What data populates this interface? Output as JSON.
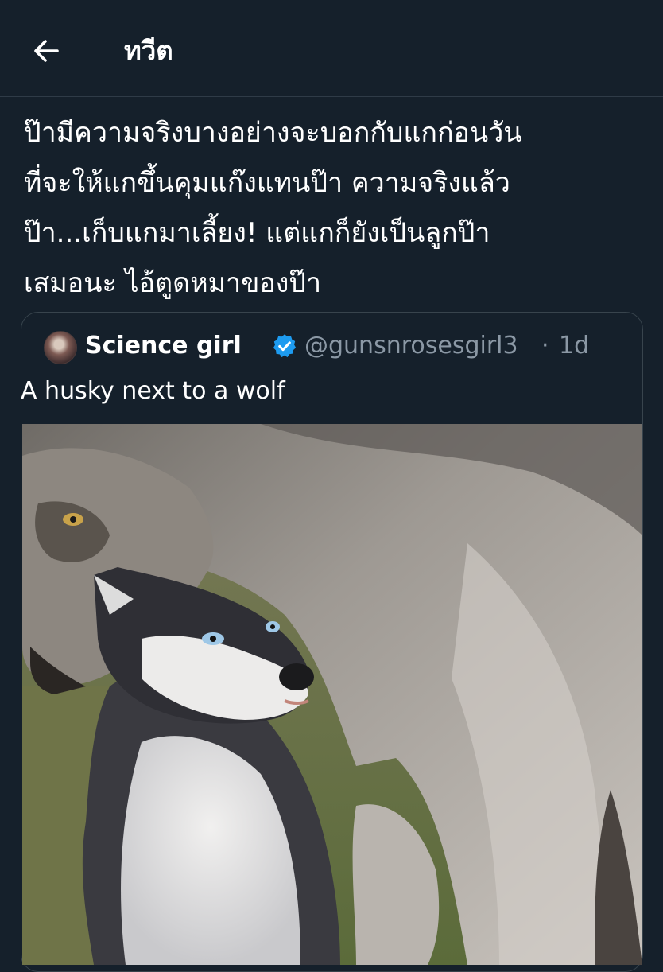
{
  "header": {
    "title": "ทวีต",
    "back_icon": "arrow-left-icon"
  },
  "tweet": {
    "text": "ป๊ามีความจริงบางอย่างจะบอกกับแกก่อนวัน\nที่จะให้แกขึ้นคุมแก๊งแทนป๊า ความจริงแล้ว\nป๊า...เก็บแกมาเลี้ยง! แต่แกก็ยังเป็นลูกป๊า\nเสมอนะ ไอ้ตูดหมาของป๊า"
  },
  "quote": {
    "author_name": "Science girl",
    "verified_icon": "verified-badge-icon",
    "handle": "@gunsnrosesgirl3",
    "separator": "·",
    "time": "1d",
    "text": "A husky next to a wolf"
  },
  "colors": {
    "background": "#15202b",
    "text_primary": "#ffffff",
    "text_secondary": "#8b98a5",
    "border": "#38444d",
    "verified_blue": "#1d9bf0"
  }
}
